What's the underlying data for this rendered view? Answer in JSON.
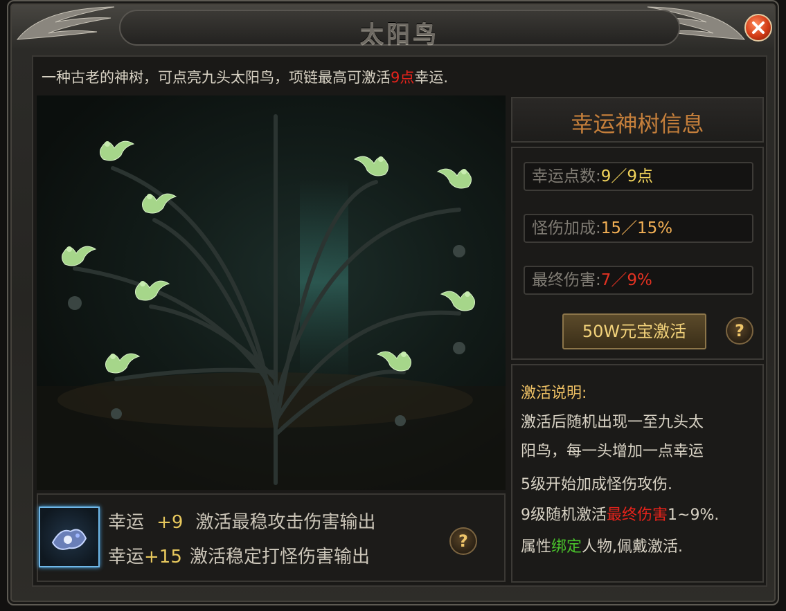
{
  "window": {
    "title": "太阳鸟"
  },
  "description": {
    "prefix": "一种古老的神树，可点亮九头太阳鸟，项链最高可激活",
    "highlight": "9点",
    "suffix": "幸运."
  },
  "info_panel": {
    "title": "幸运神树信息",
    "stats": [
      {
        "label": "幸运点数:",
        "value": "9／9点"
      },
      {
        "label": "怪伤加成:",
        "value": "15／15%"
      },
      {
        "label": "最终伤害:",
        "value": "7／9%"
      }
    ],
    "activate_label": "50W元宝激活",
    "help_label": "?"
  },
  "activation_notes": {
    "heading": "激活说明:",
    "line1": "激活后随机出现一至九头太",
    "line2": "阳鸟，每一头增加一点幸运",
    "line3": "5级开始加成怪伤攻伤.",
    "line4_prefix": "9级随机激活",
    "line4_highlight": "最终伤害",
    "line4_suffix": "1~9%.",
    "line5_prefix": "属性",
    "line5_highlight": "绑定",
    "line5_suffix": "人物,佩戴激活."
  },
  "bonuses": [
    {
      "name": "幸运",
      "amount": "+9",
      "text": "激活最稳攻击伤害输出"
    },
    {
      "name": "幸运",
      "amount": "+15",
      "text": "激活稳定打怪伤害输出"
    }
  ],
  "bottom_help_label": "?",
  "icons": [
    "close-icon",
    "help-icon",
    "item-icon",
    "sun-bird-icon"
  ],
  "colors": {
    "highlight_red": "#e8231b",
    "gold": "#f1d35b",
    "green": "#49c22b",
    "orange_title": "#c57f3b"
  }
}
